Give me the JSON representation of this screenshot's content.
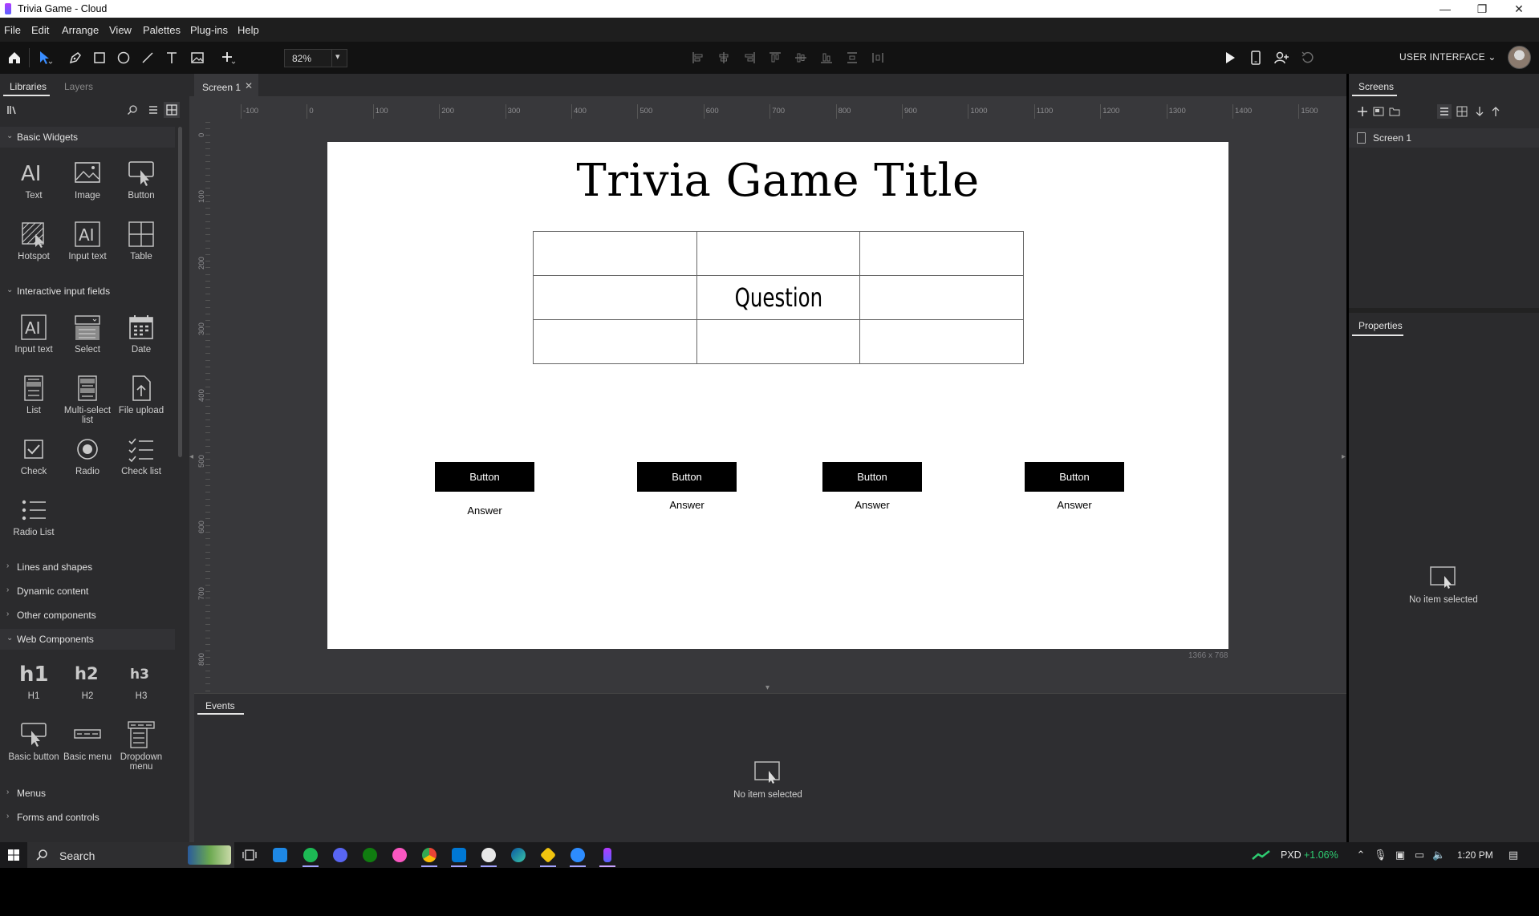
{
  "window": {
    "title": "Trivia Game - Cloud",
    "controls": [
      "—",
      "❐",
      "✕"
    ]
  },
  "menu": [
    "File",
    "Edit",
    "Arrange",
    "View",
    "Palettes",
    "Plug-ins",
    "Help"
  ],
  "toolbar": {
    "zoom": "82%",
    "mode": "USER INTERFACE"
  },
  "left_panel": {
    "tabs": [
      "Libraries",
      "Layers"
    ],
    "sections": {
      "basic_widgets": "Basic Widgets",
      "interactive": "Interactive input fields",
      "lines": "Lines and shapes",
      "dynamic": "Dynamic content",
      "other": "Other components",
      "web": "Web Components",
      "menus": "Menus",
      "forms": "Forms and controls"
    },
    "basic_widgets": [
      "Text",
      "Image",
      "Button",
      "Hotspot",
      "Input text",
      "Table"
    ],
    "interactive": [
      "Input text",
      "Select",
      "Date",
      "List",
      "Multi-select list",
      "File upload",
      "Check",
      "Radio",
      "Check list",
      "Radio List"
    ],
    "web": [
      "H1",
      "H2",
      "H3",
      "Basic button",
      "Basic menu",
      "Dropdown menu"
    ]
  },
  "document": {
    "tab": "Screen 1",
    "ruler_h": [
      "-100",
      "0",
      "100",
      "200",
      "300",
      "400",
      "500",
      "600",
      "700",
      "800",
      "900",
      "1000",
      "1100",
      "1200",
      "1300",
      "1400",
      "1500"
    ],
    "ruler_v": [
      "0",
      "100",
      "200",
      "300",
      "400",
      "500",
      "600",
      "700",
      "800"
    ],
    "canvas_size": "1366 x 768"
  },
  "artboard": {
    "title": "Trivia Game Title",
    "question": "Question",
    "buttons": [
      {
        "label": "Button",
        "answer": "Answer"
      },
      {
        "label": "Button",
        "answer": "Answer"
      },
      {
        "label": "Button",
        "answer": "Answer"
      },
      {
        "label": "Button",
        "answer": "Answer"
      }
    ]
  },
  "events": {
    "tab": "Events",
    "empty": "No item selected"
  },
  "right_panel": {
    "screens_title": "Screens",
    "screens": [
      "Screen 1"
    ],
    "properties_title": "Properties",
    "empty": "No item selected"
  },
  "taskbar": {
    "search": "Search",
    "ticker": "PXD",
    "change": "+1.06%",
    "time": "1:20 PM"
  },
  "colors": {
    "accent": "#a3a3ff",
    "positive": "#2ecc71",
    "canvas": "#38383b",
    "panel": "#2b2b2d"
  }
}
